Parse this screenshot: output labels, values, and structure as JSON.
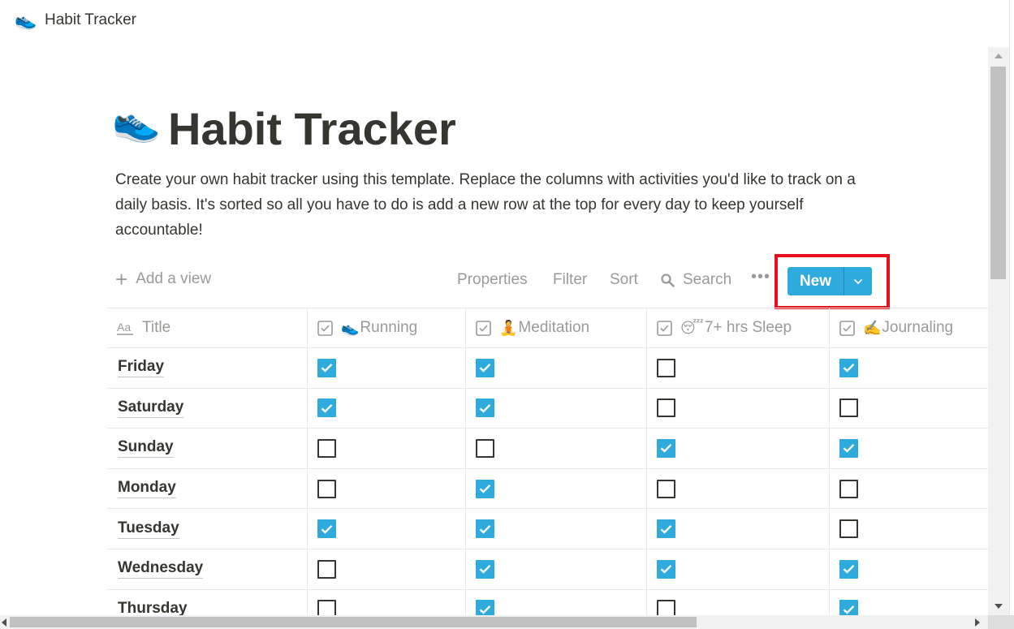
{
  "topbar": {
    "icon": "sneaker-emoji",
    "title": "Habit Tracker"
  },
  "page": {
    "icon": "👟",
    "title": "Habit Tracker",
    "description": "Create your own habit tracker using this template. Replace the columns with activities you'd like to track on a daily basis. It's sorted so all you have to do is add a new row at the top for every day to keep yourself accountable!"
  },
  "toolbar": {
    "add_view": "Add a view",
    "properties": "Properties",
    "filter": "Filter",
    "sort": "Sort",
    "search": "Search",
    "more": "•••",
    "new_label": "New"
  },
  "table": {
    "columns": [
      {
        "label": "Title",
        "icon": "text-property-icon"
      },
      {
        "label": "Running",
        "emoji": "👟",
        "icon": "checkbox-property-icon"
      },
      {
        "label": "Meditation",
        "emoji": "🧘",
        "icon": "checkbox-property-icon"
      },
      {
        "label": "7+ hrs Sleep",
        "emoji": "😴",
        "icon": "checkbox-property-icon"
      },
      {
        "label": "Journaling",
        "emoji": "✍️",
        "icon": "checkbox-property-icon"
      }
    ],
    "rows": [
      {
        "day": "Friday",
        "checks": [
          true,
          true,
          false,
          true
        ]
      },
      {
        "day": "Saturday",
        "checks": [
          true,
          true,
          false,
          false
        ]
      },
      {
        "day": "Sunday",
        "checks": [
          false,
          false,
          true,
          true
        ]
      },
      {
        "day": "Monday",
        "checks": [
          false,
          true,
          false,
          false
        ]
      },
      {
        "day": "Tuesday",
        "checks": [
          true,
          true,
          true,
          false
        ]
      },
      {
        "day": "Wednesday",
        "checks": [
          false,
          true,
          true,
          true
        ]
      },
      {
        "day": "Thursday",
        "checks": [
          false,
          true,
          false,
          true
        ]
      }
    ]
  },
  "colors": {
    "accent": "#2eaadc",
    "highlight": "#e8101d",
    "text": "#37352f",
    "muted": "#9b9a97"
  }
}
